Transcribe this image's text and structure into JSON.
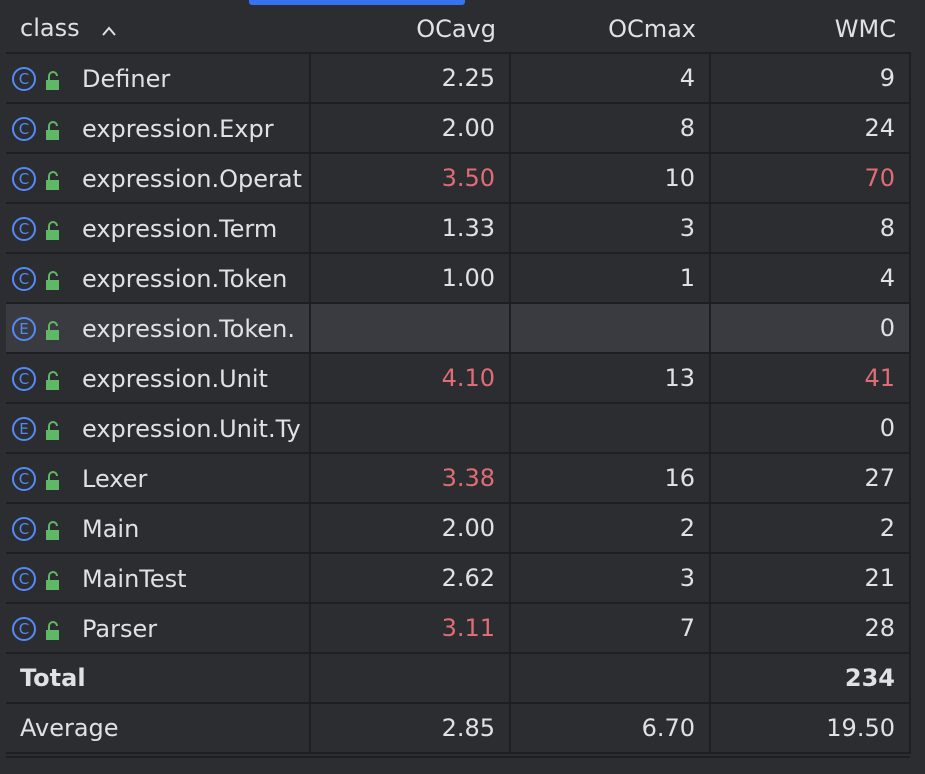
{
  "columns": {
    "class": "class",
    "ocavg": "OCavg",
    "ocmax": "OCmax",
    "wmc": "WMC"
  },
  "rows": [
    {
      "icon": "C",
      "name": "Definer",
      "ocavg": "2.25",
      "ocmax": "4",
      "wmc": "9"
    },
    {
      "icon": "C",
      "name": "expression.Expr",
      "ocavg": "2.00",
      "ocmax": "8",
      "wmc": "24"
    },
    {
      "icon": "C",
      "name": "expression.Operat",
      "ocavg": "3.50",
      "ocmax": "10",
      "wmc": "70"
    },
    {
      "icon": "C",
      "name": "expression.Term",
      "ocavg": "1.33",
      "ocmax": "3",
      "wmc": "8"
    },
    {
      "icon": "C",
      "name": "expression.Token",
      "ocavg": "1.00",
      "ocmax": "1",
      "wmc": "4"
    },
    {
      "icon": "E",
      "name": "expression.Token.",
      "ocavg": "",
      "ocmax": "",
      "wmc": "0"
    },
    {
      "icon": "C",
      "name": "expression.Unit",
      "ocavg": "4.10",
      "ocmax": "13",
      "wmc": "41"
    },
    {
      "icon": "E",
      "name": "expression.Unit.Ty",
      "ocavg": "",
      "ocmax": "",
      "wmc": "0"
    },
    {
      "icon": "C",
      "name": "Lexer",
      "ocavg": "3.38",
      "ocmax": "16",
      "wmc": "27"
    },
    {
      "icon": "C",
      "name": "Main",
      "ocavg": "2.00",
      "ocmax": "2",
      "wmc": "2"
    },
    {
      "icon": "C",
      "name": "MainTest",
      "ocavg": "2.62",
      "ocmax": "3",
      "wmc": "21"
    },
    {
      "icon": "C",
      "name": "Parser",
      "ocavg": "3.11",
      "ocmax": "7",
      "wmc": "28"
    }
  ],
  "total": {
    "label": "Total",
    "ocavg": "",
    "ocmax": "",
    "wmc": "234"
  },
  "average": {
    "label": "Average",
    "ocavg": "2.85",
    "ocmax": "6.70",
    "wmc": "19.50"
  },
  "colors": {
    "background": "#2b2d30",
    "grid": "#1e1f22",
    "text": "#dfe1e5",
    "warning": "#e06c75",
    "icon_blue": "#548af7",
    "lock_green": "#5fb865",
    "selection": "#393b40",
    "scroll_accent": "#3574f0"
  }
}
